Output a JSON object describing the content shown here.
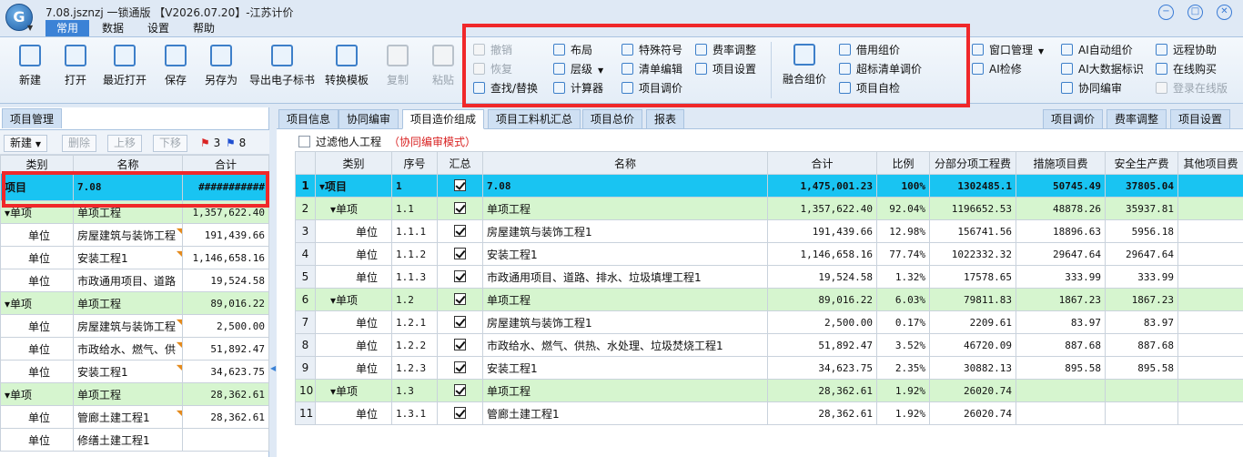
{
  "title": "7.08.jsznzj 一锁通版 【V2026.07.20】-江苏计价",
  "menu_tabs": [
    "常用",
    "数据",
    "设置",
    "帮助"
  ],
  "ribbon": {
    "big_buttons": [
      "新建",
      "打开",
      "最近打开",
      "保存",
      "另存为",
      "导出电子标书",
      "转换模板",
      "复制",
      "粘贴"
    ],
    "group1_col1": [
      "撤销",
      "恢复",
      "查找/替换"
    ],
    "group1_col2": [
      "布局",
      "层级",
      "计算器"
    ],
    "group1_col3": [
      "特殊符号",
      "清单编辑",
      "项目调价"
    ],
    "group1_col4": [
      "费率调整",
      "项目设置"
    ],
    "group2_big": "融合组价",
    "group2_col": [
      "借用组价",
      "超标清单调价",
      "项目自检"
    ],
    "group3_col1": [
      "窗口管理",
      "AI检修"
    ],
    "group3_col2": [
      "AI自动组价",
      "AI大数据标识",
      "协同编审"
    ],
    "group3_col3": [
      "远程协助",
      "在线购买",
      "登录在线版"
    ]
  },
  "left_panel": {
    "tab": "项目管理",
    "toolbar": {
      "new": "新建",
      "delete": "删除",
      "move_up": "上移",
      "move_down": "下移",
      "red_flag_count": "3",
      "blue_flag_count": "8"
    },
    "headers": [
      "类别",
      "名称",
      "合计"
    ],
    "rows": [
      {
        "type": "项目",
        "name": "7.08",
        "total": "###########"
      },
      {
        "type": "单项",
        "name": "单项工程",
        "total": "1,357,622.40"
      },
      {
        "type": "单位",
        "name": "房屋建筑与装饰工程",
        "total": "191,439.66"
      },
      {
        "type": "单位",
        "name": "安装工程1",
        "total": "1,146,658.16"
      },
      {
        "type": "单位",
        "name": "市政通用项目、道路",
        "total": "19,524.58"
      },
      {
        "type": "单项",
        "name": "单项工程",
        "total": "89,016.22"
      },
      {
        "type": "单位",
        "name": "房屋建筑与装饰工程",
        "total": "2,500.00"
      },
      {
        "type": "单位",
        "name": "市政给水、燃气、供",
        "total": "51,892.47"
      },
      {
        "type": "单位",
        "name": "安装工程1",
        "total": "34,623.75"
      },
      {
        "type": "单项",
        "name": "单项工程",
        "total": "28,362.61"
      },
      {
        "type": "单位",
        "name": "管廊土建工程1",
        "total": "28,362.61"
      },
      {
        "type": "单位",
        "name": "修缮土建工程1",
        "total": ""
      }
    ]
  },
  "right_panel": {
    "tabs": [
      "项目信息",
      "协同编审",
      "项目造价组成",
      "项目工料机汇总",
      "项目总价",
      "报表"
    ],
    "right_tabs": [
      "项目调价",
      "费率调整",
      "项目设置"
    ],
    "filter_label": "过滤他人工程",
    "filter_mode": "（协同编审模式）",
    "headers": [
      "类别",
      "序号",
      "汇总",
      "名称",
      "合计",
      "比例",
      "分部分项工程费",
      "措施项目费",
      "安全生产费",
      "其他项目费"
    ],
    "rows": [
      {
        "n": "1",
        "type": "项目",
        "seq": "1",
        "name": "7.08",
        "total": "1,475,001.23",
        "ratio": "100%",
        "fb": "1302485.1",
        "cs": "50745.49",
        "aq": "37805.04",
        "qt": ""
      },
      {
        "n": "2",
        "type": "单项",
        "seq": "1.1",
        "name": "单项工程",
        "total": "1,357,622.40",
        "ratio": "92.04%",
        "fb": "1196652.53",
        "cs": "48878.26",
        "aq": "35937.81",
        "qt": ""
      },
      {
        "n": "3",
        "type": "单位",
        "seq": "1.1.1",
        "name": "房屋建筑与装饰工程1",
        "total": "191,439.66",
        "ratio": "12.98%",
        "fb": "156741.56",
        "cs": "18896.63",
        "aq": "5956.18",
        "qt": ""
      },
      {
        "n": "4",
        "type": "单位",
        "seq": "1.1.2",
        "name": "安装工程1",
        "total": "1,146,658.16",
        "ratio": "77.74%",
        "fb": "1022332.32",
        "cs": "29647.64",
        "aq": "29647.64",
        "qt": ""
      },
      {
        "n": "5",
        "type": "单位",
        "seq": "1.1.3",
        "name": "市政通用项目、道路、排水、垃圾填埋工程1",
        "total": "19,524.58",
        "ratio": "1.32%",
        "fb": "17578.65",
        "cs": "333.99",
        "aq": "333.99",
        "qt": ""
      },
      {
        "n": "6",
        "type": "单项",
        "seq": "1.2",
        "name": "单项工程",
        "total": "89,016.22",
        "ratio": "6.03%",
        "fb": "79811.83",
        "cs": "1867.23",
        "aq": "1867.23",
        "qt": ""
      },
      {
        "n": "7",
        "type": "单位",
        "seq": "1.2.1",
        "name": "房屋建筑与装饰工程1",
        "total": "2,500.00",
        "ratio": "0.17%",
        "fb": "2209.61",
        "cs": "83.97",
        "aq": "83.97",
        "qt": ""
      },
      {
        "n": "8",
        "type": "单位",
        "seq": "1.2.2",
        "name": "市政给水、燃气、供热、水处理、垃圾焚烧工程1",
        "total": "51,892.47",
        "ratio": "3.52%",
        "fb": "46720.09",
        "cs": "887.68",
        "aq": "887.68",
        "qt": ""
      },
      {
        "n": "9",
        "type": "单位",
        "seq": "1.2.3",
        "name": "安装工程1",
        "total": "34,623.75",
        "ratio": "2.35%",
        "fb": "30882.13",
        "cs": "895.58",
        "aq": "895.58",
        "qt": ""
      },
      {
        "n": "10",
        "type": "单项",
        "seq": "1.3",
        "name": "单项工程",
        "total": "28,362.61",
        "ratio": "1.92%",
        "fb": "26020.74",
        "cs": "",
        "aq": "",
        "qt": ""
      },
      {
        "n": "11",
        "type": "单位",
        "seq": "1.3.1",
        "name": "管廊土建工程1",
        "total": "28,362.61",
        "ratio": "1.92%",
        "fb": "26020.74",
        "cs": "",
        "aq": "",
        "qt": ""
      }
    ]
  },
  "colors": {
    "accent": "#3b82d6",
    "highlight_row": "#19c4f2",
    "unit_row": "#d6f5cf",
    "annotation": "#f0282a"
  }
}
